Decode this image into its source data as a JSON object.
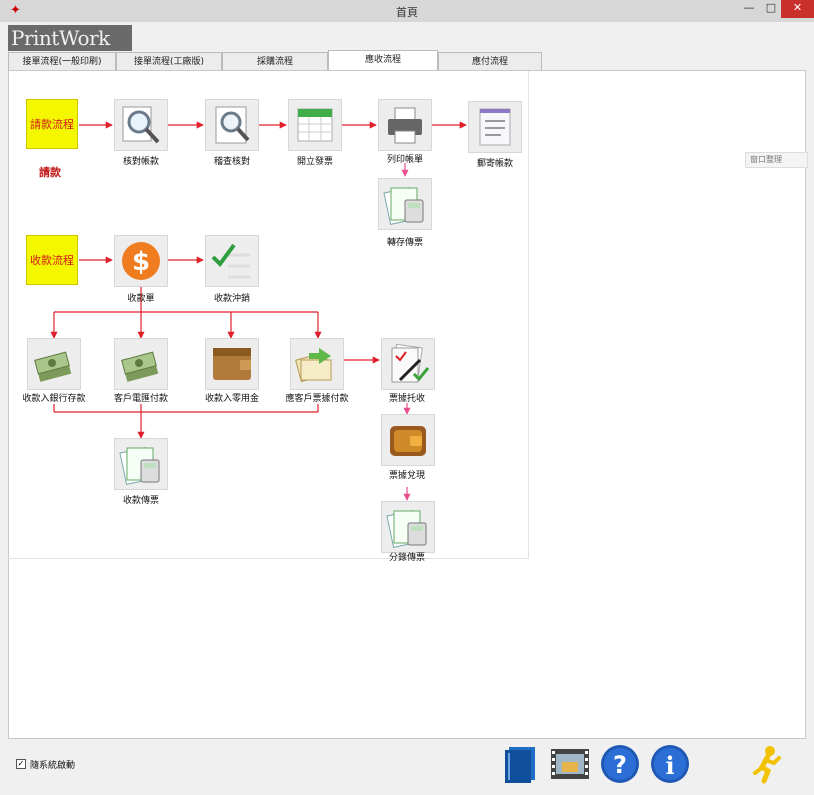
{
  "window": {
    "title": "首頁",
    "app_icon": "app-icon",
    "controls": {
      "minimize": "—",
      "maximize": "□",
      "close": "✕"
    }
  },
  "logo": "PrintWork",
  "tabs": [
    {
      "label": "接單流程(一般印刷)",
      "active": false
    },
    {
      "label": "接單流程(工廠版)",
      "active": false
    },
    {
      "label": "採購流程",
      "active": false
    },
    {
      "label": "應收流程",
      "active": true
    },
    {
      "label": "應付流程",
      "active": false
    }
  ],
  "side_button": "窗口整理",
  "flow": {
    "billing_start": "請款流程",
    "billing_note": "請款",
    "collect_start": "收款流程",
    "nodes": {
      "ar_check": "核對帳款",
      "audit_check": "稽查核對",
      "open_invoice": "開立發票",
      "print_bill": "列印帳單",
      "delivery_report": "郵寄帳款",
      "transfer_voucher": "轉存傳票",
      "receive_money": "收款單",
      "offset_collect": "收款沖銷",
      "bank_deposit": "收款入銀行存款",
      "customer_remit": "客戶電匯付款",
      "cash_receive": "收款入零用金",
      "bill_receive": "應客戶票據付款",
      "receive_voucher": "收款傳票",
      "bill_collect": "票據托收",
      "bill_cash": "票據兌現",
      "split_voucher": "分錄傳票"
    }
  },
  "footer": {
    "checkbox_label": "隨系統啟動",
    "checked": true
  },
  "colors": {
    "accent_red": "#e0202a",
    "yellow": "#f4f700"
  }
}
